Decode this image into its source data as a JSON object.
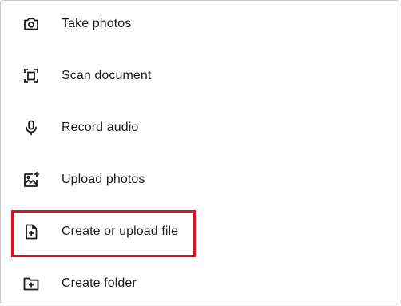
{
  "menu": {
    "items": [
      {
        "label": "Take photos",
        "icon": "camera-icon"
      },
      {
        "label": "Scan document",
        "icon": "scan-document-icon"
      },
      {
        "label": "Record audio",
        "icon": "microphone-icon"
      },
      {
        "label": "Upload photos",
        "icon": "upload-photos-icon"
      },
      {
        "label": "Create or upload file",
        "icon": "create-file-icon"
      },
      {
        "label": "Create folder",
        "icon": "create-folder-icon"
      }
    ]
  },
  "colors": {
    "text": "#1e1919",
    "icon": "#1e1919",
    "highlight": "#e0101e"
  }
}
